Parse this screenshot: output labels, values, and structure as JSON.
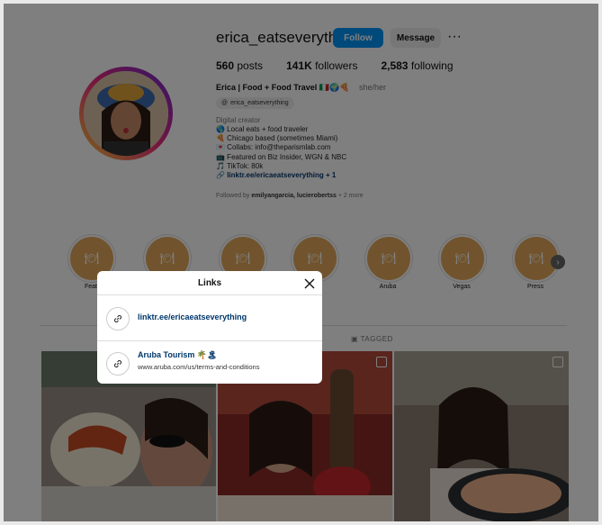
{
  "profile": {
    "username": "erica_eatseverything",
    "follow_label": "Follow",
    "message_label": "Message",
    "more_label": "···",
    "stats": {
      "posts_count": "560",
      "posts_label": "posts",
      "followers_count": "141K",
      "followers_label": "followers",
      "following_count": "2,583",
      "following_label": "following"
    },
    "full_name": "Erica | Food + Food Travel 🇮🇹🌍🍕",
    "pronouns": "she/her",
    "threads_handle": "erica_eatseverything",
    "category": "Digital creator",
    "bio_lines": [
      "🌎 Local eats + food traveler",
      "🍕 Chicago based (sometimes Miami)",
      "💌 Collabs: info@theparismlab.com",
      "📺 Featured on Biz Insider, WGN & NBC",
      "🎵 TikTok: 80k"
    ],
    "bio_link": "linktr.ee/ericaeatseverything + 1",
    "followed_by_prefix": "Followed by",
    "followed_by_names": "emilyangarcia, lucierobertss",
    "followed_by_suffix": "+ 2 more"
  },
  "highlights": [
    {
      "label": "Feat"
    },
    {
      "label": ""
    },
    {
      "label": ""
    },
    {
      "label": ""
    },
    {
      "label": "Aruba"
    },
    {
      "label": "Vegas"
    },
    {
      "label": "Press"
    }
  ],
  "tabs": {
    "tagged_label": "TAGGED"
  },
  "modal": {
    "title": "Links",
    "links": [
      {
        "title": "linktr.ee/ericaeatseverything",
        "url": ""
      },
      {
        "title": "Aruba Tourism 🌴🏝",
        "url": "www.aruba.com/us/terms-and-conditions"
      }
    ]
  },
  "colors": {
    "accent": "#0095f6",
    "link": "#00376b",
    "highlight": "#e3a85c"
  }
}
